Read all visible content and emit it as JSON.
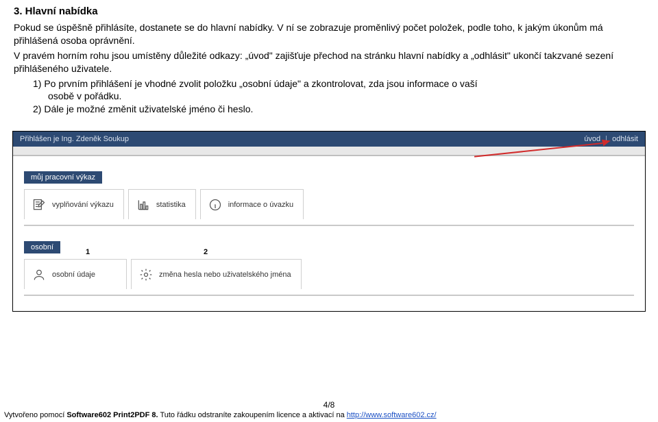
{
  "heading": "3. Hlavní nabídka",
  "paragraphs": {
    "p1": "Pokud se úspěšně přihlásíte, dostanete se do hlavní nabídky. V ní se zobrazuje proměnlivý počet položek, podle toho, k jakým úkonům má přihlášená osoba oprávnění.",
    "p2": "V pravém horním rohu jsou umístěny důležité odkazy: „úvod\" zajišťuje přechod na stránku hlavní nabídky a „odhlásit\" ukončí takzvané sezení přihlášeného uživatele.",
    "li1a": "1) Po prvním přihlášení je vhodné zvolit položku „osobní údaje\" a zkontrolovat, zda jsou informace o vaší",
    "li1b": "osobě v pořádku.",
    "li2": "2) Dále je možné změnit uživatelské jméno či heslo."
  },
  "app": {
    "logged_in_label": "Přihlášen je Ing. Zdeněk Soukup",
    "link_uvod": "úvod",
    "link_odhlasit": "odhlásit",
    "section1_title": "můj pracovní výkaz",
    "section1_items": [
      "vyplňování výkazu",
      "statistika",
      "informace o úvazku"
    ],
    "section2_title": "osobní",
    "section2_items": [
      "osobní údaje",
      "změna hesla nebo uživatelského jména"
    ],
    "annotation1": "1",
    "annotation2": "2"
  },
  "footer": {
    "page": "4/8",
    "prefix": "Vytvořeno pomocí ",
    "product": "Software602 Print2PDF 8.",
    "rest": " Tuto řádku odstraníte zakoupením licence a aktivací na ",
    "url": "http://www.software602.cz/"
  }
}
